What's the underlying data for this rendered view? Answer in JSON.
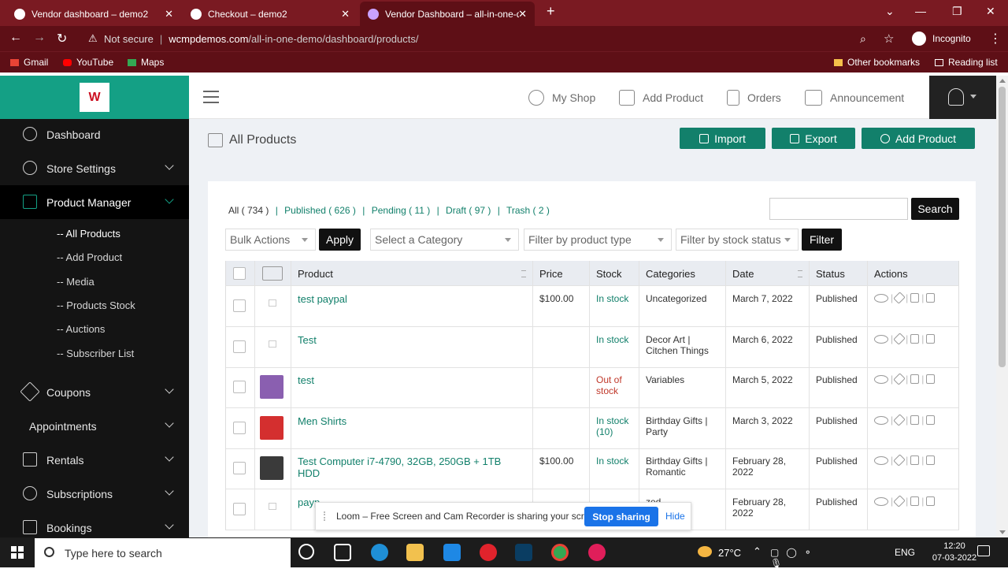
{
  "browser": {
    "tabs": [
      {
        "title": "Vendor dashboard – demo2"
      },
      {
        "title": "Checkout – demo2"
      },
      {
        "title": "Vendor Dashboard – all-in-one-d"
      }
    ],
    "not_secure": "Not secure",
    "url_host": "wcmpdemos.com",
    "url_path": "/all-in-one-demo/dashboard/products/",
    "incognito": "Incognito",
    "bookmarks": [
      "Gmail",
      "YouTube",
      "Maps"
    ],
    "other_bookmarks": "Other bookmarks",
    "reading_list": "Reading list"
  },
  "sidebar": {
    "items": [
      {
        "label": "Dashboard",
        "icon": "dashboard-icon"
      },
      {
        "label": "Store Settings",
        "icon": "gear-icon"
      },
      {
        "label": "Product Manager",
        "icon": "product-icon"
      },
      {
        "label": "Coupons",
        "icon": "tag-icon"
      },
      {
        "label": "Appointments",
        "icon": ""
      },
      {
        "label": "Rentals",
        "icon": "rentals-icon"
      },
      {
        "label": "Subscriptions",
        "icon": "history-icon"
      },
      {
        "label": "Bookings",
        "icon": "calendar-icon"
      }
    ],
    "sub_items": [
      "-- All Products",
      "-- Add Product",
      "-- Media",
      "-- Products Stock",
      "-- Auctions",
      "-- Subscriber List"
    ]
  },
  "topbar": {
    "links": [
      "My Shop",
      "Add Product",
      "Orders",
      "Announcement"
    ]
  },
  "page": {
    "title": "All Products",
    "buttons": [
      "Import",
      "Export",
      "Add Product"
    ]
  },
  "filters": {
    "status": {
      "all": "All ( 734 )",
      "published": "Published ( 626 )",
      "pending": "Pending ( 11 )",
      "draft": "Draft ( 97 )",
      "trash": "Trash ( 2 )"
    },
    "search_button": "Search",
    "bulk_actions": "Bulk Actions",
    "apply": "Apply",
    "category": "Select a Category",
    "product_type": "Filter by product type",
    "stock_status": "Filter by stock status",
    "filter": "Filter"
  },
  "table": {
    "headers": [
      "Product",
      "Price",
      "Stock",
      "Categories",
      "Date",
      "Status",
      "Actions"
    ],
    "rows": [
      {
        "product": "test paypal",
        "price": "$100.00",
        "stock": "In stock",
        "stock_state": "in",
        "categories": "Uncategorized",
        "date": "March 7, 2022",
        "status": "Published",
        "thumb": "none"
      },
      {
        "product": "Test",
        "price": "",
        "stock": "In stock",
        "stock_state": "in",
        "categories": "Decor Art | Citchen Things",
        "date": "March 6, 2022",
        "status": "Published",
        "thumb": "none"
      },
      {
        "product": "test",
        "price": "",
        "stock": "Out of stock",
        "stock_state": "out",
        "categories": "Variables",
        "date": "March 5, 2022",
        "status": "Published",
        "thumb": "purple"
      },
      {
        "product": "Men Shirts",
        "price": "",
        "stock": "In stock (10)",
        "stock_state": "in",
        "categories": "Birthday Gifts | Party",
        "date": "March 3, 2022",
        "status": "Published",
        "thumb": "red"
      },
      {
        "product": "Test Computer i7-4790, 32GB, 250GB + 1TB HDD",
        "price": "$100.00",
        "stock": "In stock",
        "stock_state": "in",
        "categories": "Birthday Gifts | Romantic",
        "date": "February 28, 2022",
        "status": "Published",
        "thumb": "dark"
      },
      {
        "product": "payp",
        "price": "",
        "stock": "",
        "stock_state": "in",
        "categories": "zed",
        "date": "February 28, 2022",
        "status": "Published",
        "thumb": "none"
      }
    ]
  },
  "loom": {
    "message": "Loom – Free Screen and Cam Recorder is sharing your screen.",
    "stop": "Stop sharing",
    "hide": "Hide"
  },
  "taskbar": {
    "search_placeholder": "Type here to search",
    "weather": "27°C",
    "lang": "ENG",
    "time": "12:20",
    "date": "07-03-2022"
  },
  "colors": {
    "accent": "#12806b",
    "sidebar_bg": "#141414",
    "browser_frame": "#7a1a22"
  }
}
